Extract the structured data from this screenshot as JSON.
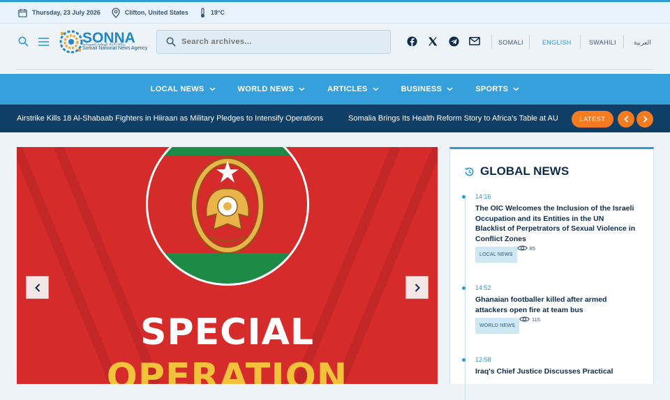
{
  "infobar": {
    "date": "Thursday, 23 July 2026",
    "location": "Clifton, United States",
    "temperature": "19°C"
  },
  "header": {
    "logo_text": "SONNA",
    "logo_subtitle": "Somali National News Agency",
    "logo_arabic": "وكالة الأنباء الوطنية الصومالية",
    "search_placeholder": "Search archives...",
    "languages": [
      {
        "label": "SOMALI"
      },
      {
        "label": "ENGLISH"
      },
      {
        "label": "SWAHILI"
      },
      {
        "label": "العربية"
      }
    ],
    "active_language": "ENGLISH"
  },
  "nav": {
    "items": [
      {
        "label": "LOCAL NEWS"
      },
      {
        "label": "WORLD NEWS"
      },
      {
        "label": "ARTICLES"
      },
      {
        "label": "BUSINESS"
      },
      {
        "label": "SPORTS"
      }
    ]
  },
  "ticker": {
    "items": [
      "Airstrike Kills 18 Al-Shabaab Fighters in Hiiraan as Military Pledges to Intensify Operations",
      "Somalia Brings Its Health Reform Story to Africa's Table at AU"
    ],
    "latest_label": "LATEST"
  },
  "hero": {
    "title_line1": "SPECIAL",
    "title_line2": "OPERATION"
  },
  "sidebar": {
    "title": "GLOBAL NEWS",
    "news": [
      {
        "time": "14:16",
        "headline": "The OIC Welcomes the Inclusion of the Israeli Occupation and its Entities in the UN Blacklist of Perpetrators of Sexual Violence in Conflict Zones",
        "category": "LOCAL NEWS",
        "views": "85"
      },
      {
        "time": "14:52",
        "headline": "Ghanaian footballer killed after armed attackers open fire at team bus",
        "category": "WORLD NEWS",
        "views": "115"
      },
      {
        "time": "12:58",
        "headline": "Iraq's Chief Justice Discusses Practical",
        "category": "",
        "views": ""
      }
    ]
  },
  "colors": {
    "accent": "#2f9bd8",
    "ticker_bg": "#0f3e66",
    "latest": "#f57b20",
    "hero_bg": "#d62b2b"
  }
}
